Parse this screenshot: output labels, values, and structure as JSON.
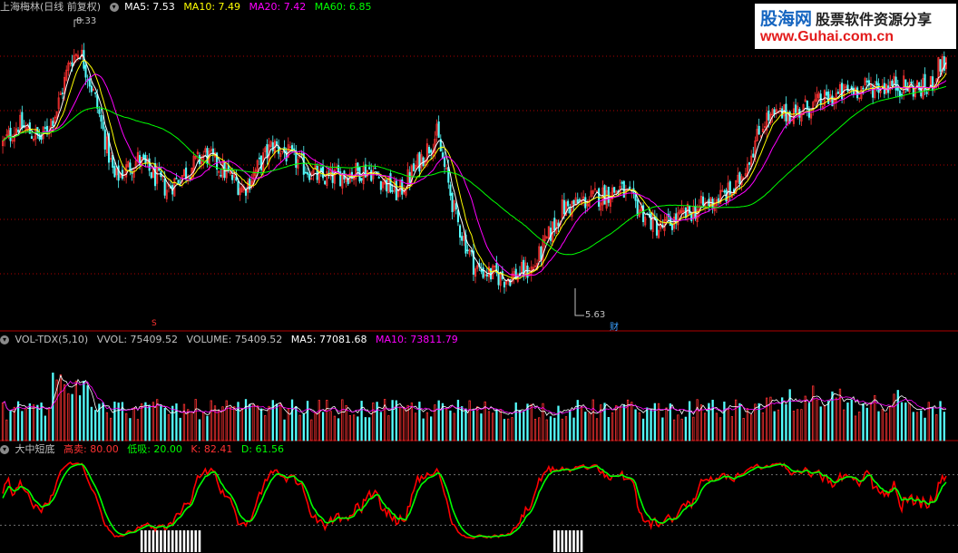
{
  "main_header": {
    "title": "上海梅林(日线 前复权)",
    "ma5": "MA5: 7.53",
    "ma10": "MA10: 7.49",
    "ma20": "MA20: 7.42",
    "ma60": "MA60: 6.85"
  },
  "vol_header": {
    "title": "VOL-TDX(5,10)",
    "vvol": "VVOL: 75409.52",
    "volume": "VOLUME: 75409.52",
    "ma5": "MA5: 77081.68",
    "ma10": "MA10: 73811.79"
  },
  "kd_header": {
    "title": "大中短底",
    "high_sell": "高卖: 80.00",
    "low_buy": "低吸: 20.00",
    "k": "K: 82.41",
    "d": "D: 61.56"
  },
  "annotations": {
    "high": "8.33",
    "low": "5.63",
    "marker_s": "S",
    "marker_cai": "财"
  },
  "logo": {
    "line1": "股海网",
    "line1b": "股票软件资源分享",
    "line2": "www.Guhai.com.cn"
  },
  "colors": {
    "up": "#ff3232",
    "down": "#54ffff",
    "ma5": "#ffffff",
    "ma10": "#ffff00",
    "ma20": "#ff00ff",
    "ma60": "#00ff00",
    "k_line": "#ff0000",
    "d_line": "#00ff00",
    "grid": "#b00000"
  },
  "chart_data": [
    {
      "type": "candlestick",
      "title": "上海梅林(日线 前复权)",
      "y_range": [
        5.4,
        8.5
      ],
      "high_point": 8.33,
      "low_point": 5.63,
      "legend": [
        "MA5: 7.53",
        "MA10: 7.49",
        "MA20: 7.42",
        "MA60: 6.85"
      ],
      "waypoints": [
        [
          0,
          7.25
        ],
        [
          8,
          7.45
        ],
        [
          20,
          7.3
        ],
        [
          28,
          7.6
        ],
        [
          35,
          8.1
        ],
        [
          40,
          8.2
        ],
        [
          48,
          7.7
        ],
        [
          58,
          6.9
        ],
        [
          70,
          7.1
        ],
        [
          85,
          6.8
        ],
        [
          105,
          7.15
        ],
        [
          125,
          6.8
        ],
        [
          140,
          7.25
        ],
        [
          165,
          6.9
        ],
        [
          190,
          7.0
        ],
        [
          205,
          6.75
        ],
        [
          225,
          7.35
        ],
        [
          235,
          6.5
        ],
        [
          245,
          6.0
        ],
        [
          260,
          5.9
        ],
        [
          275,
          6.0
        ],
        [
          290,
          6.6
        ],
        [
          320,
          6.8
        ],
        [
          340,
          6.4
        ],
        [
          360,
          6.6
        ],
        [
          380,
          6.8
        ],
        [
          395,
          7.5
        ],
        [
          415,
          7.6
        ],
        [
          440,
          7.8
        ],
        [
          460,
          7.85
        ],
        [
          480,
          7.8
        ],
        [
          487,
          8.1
        ],
        [
          490,
          8.0
        ]
      ],
      "candles": 490
    },
    {
      "type": "bar",
      "title": "VOL-TDX(5,10)",
      "legend": [
        "VVOL: 75409.52",
        "VOLUME: 75409.52",
        "MA5: 77081.68",
        "MA10: 73811.79"
      ]
    },
    {
      "type": "line",
      "title": "大中短底",
      "y_range": [
        0,
        100
      ],
      "reference_lines": [
        80,
        20
      ],
      "legend": [
        "高卖: 80.00",
        "低吸: 20.00",
        "K: 82.41",
        "D: 61.56"
      ]
    }
  ]
}
